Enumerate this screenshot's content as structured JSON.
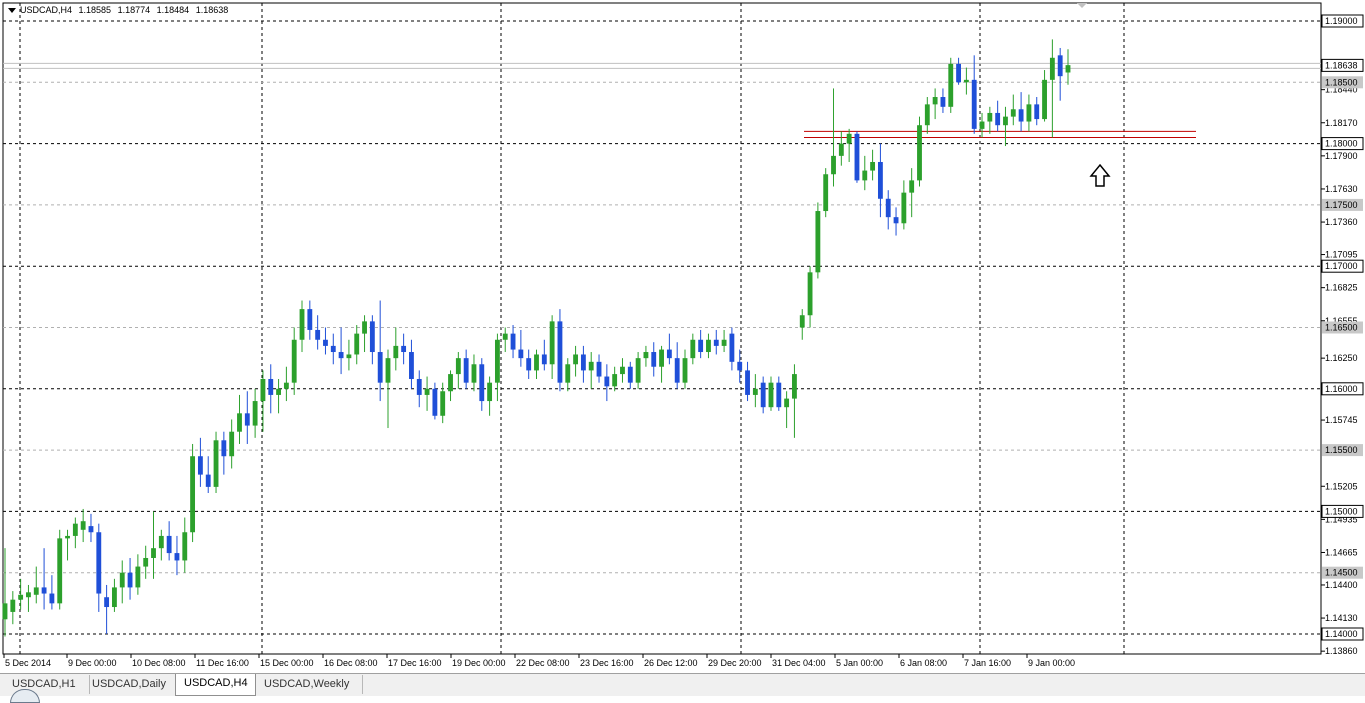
{
  "header": {
    "symbol": "USDCAD,H4",
    "open": "1.18585",
    "high": "1.18774",
    "low": "1.18484",
    "close": "1.18638"
  },
  "tabs": [
    {
      "label": "USDCAD,H1",
      "active": false
    },
    {
      "label": "USDCAD,Daily",
      "active": false
    },
    {
      "label": "USDCAD,H4",
      "active": true
    },
    {
      "label": "USDCAD,Weekly",
      "active": false
    }
  ],
  "colors": {
    "bull": "#2ca02c",
    "bear": "#1f4fd8",
    "resistance": "#c00000",
    "grid": "#000000",
    "minor_level": "#b0b0b0"
  },
  "chart_data": {
    "type": "candlestick",
    "timeframe": "H4",
    "ylim": [
      1.1363,
      1.192
    ],
    "price_ticks": [
      "1.19000",
      "1.18440",
      "1.18170",
      "1.17900",
      "1.17630",
      "1.17360",
      "1.17095",
      "1.16825",
      "1.16555",
      "1.16250",
      "1.15745",
      "1.15205",
      "1.14935",
      "1.14665",
      "1.14400",
      "1.14130",
      "1.13860"
    ],
    "major_levels": [
      "1.19000",
      "1.18000",
      "1.17000",
      "1.16000",
      "1.15000",
      "1.14000"
    ],
    "minor_levels": [
      "1.18500",
      "1.17500",
      "1.16500",
      "1.15500",
      "1.14500"
    ],
    "current_price": "1.18638",
    "current_price_value": 1.18638,
    "time_labels": [
      "5 Dec 2014",
      "9 Dec 00:00",
      "10 Dec 08:00",
      "11 Dec 16:00",
      "15 Dec 00:00",
      "16 Dec 08:00",
      "17 Dec 16:00",
      "19 Dec 00:00",
      "22 Dec 08:00",
      "23 Dec 16:00",
      "26 Dec 12:00",
      "29 Dec 20:00",
      "31 Dec 04:00",
      "5 Jan 00:00",
      "6 Jan 08:00",
      "7 Jan 16:00",
      "9 Jan 00:00"
    ],
    "resistance_zone": [
      1.1805,
      1.181
    ],
    "arrow": "up",
    "grid": true,
    "candles": [
      {
        "o": 1.1412,
        "h": 1.147,
        "l": 1.1398,
        "c": 1.1425
      },
      {
        "o": 1.1418,
        "h": 1.1435,
        "l": 1.1408,
        "c": 1.1428
      },
      {
        "o": 1.1428,
        "h": 1.1445,
        "l": 1.142,
        "c": 1.1432
      },
      {
        "o": 1.143,
        "h": 1.144,
        "l": 1.1418,
        "c": 1.1434
      },
      {
        "o": 1.1432,
        "h": 1.1455,
        "l": 1.1425,
        "c": 1.1438
      },
      {
        "o": 1.1438,
        "h": 1.147,
        "l": 1.142,
        "c": 1.1433
      },
      {
        "o": 1.1433,
        "h": 1.1448,
        "l": 1.142,
        "c": 1.1425
      },
      {
        "o": 1.1425,
        "h": 1.1485,
        "l": 1.142,
        "c": 1.1478
      },
      {
        "o": 1.1478,
        "h": 1.1485,
        "l": 1.146,
        "c": 1.148
      },
      {
        "o": 1.148,
        "h": 1.1495,
        "l": 1.147,
        "c": 1.149
      },
      {
        "o": 1.1485,
        "h": 1.1502,
        "l": 1.1475,
        "c": 1.1492
      },
      {
        "o": 1.1488,
        "h": 1.1498,
        "l": 1.1475,
        "c": 1.1483
      },
      {
        "o": 1.1483,
        "h": 1.149,
        "l": 1.1418,
        "c": 1.1433
      },
      {
        "o": 1.143,
        "h": 1.144,
        "l": 1.14,
        "c": 1.1422
      },
      {
        "o": 1.1422,
        "h": 1.1445,
        "l": 1.1418,
        "c": 1.1438
      },
      {
        "o": 1.1438,
        "h": 1.146,
        "l": 1.1425,
        "c": 1.145
      },
      {
        "o": 1.145,
        "h": 1.1462,
        "l": 1.1428,
        "c": 1.1438
      },
      {
        "o": 1.1438,
        "h": 1.1465,
        "l": 1.1432,
        "c": 1.1455
      },
      {
        "o": 1.1455,
        "h": 1.1472,
        "l": 1.1445,
        "c": 1.1462
      },
      {
        "o": 1.1462,
        "h": 1.15,
        "l": 1.1445,
        "c": 1.147
      },
      {
        "o": 1.147,
        "h": 1.1485,
        "l": 1.146,
        "c": 1.148
      },
      {
        "o": 1.148,
        "h": 1.1492,
        "l": 1.146,
        "c": 1.1466
      },
      {
        "o": 1.1466,
        "h": 1.148,
        "l": 1.1448,
        "c": 1.146
      },
      {
        "o": 1.146,
        "h": 1.1495,
        "l": 1.145,
        "c": 1.1483
      },
      {
        "o": 1.1483,
        "h": 1.1555,
        "l": 1.1475,
        "c": 1.1545
      },
      {
        "o": 1.1545,
        "h": 1.156,
        "l": 1.152,
        "c": 1.153
      },
      {
        "o": 1.153,
        "h": 1.1545,
        "l": 1.1515,
        "c": 1.152
      },
      {
        "o": 1.152,
        "h": 1.1565,
        "l": 1.1515,
        "c": 1.1558
      },
      {
        "o": 1.1558,
        "h": 1.1565,
        "l": 1.153,
        "c": 1.1545
      },
      {
        "o": 1.1545,
        "h": 1.1575,
        "l": 1.1535,
        "c": 1.1565
      },
      {
        "o": 1.1565,
        "h": 1.1595,
        "l": 1.1555,
        "c": 1.158
      },
      {
        "o": 1.158,
        "h": 1.1598,
        "l": 1.1555,
        "c": 1.157
      },
      {
        "o": 1.157,
        "h": 1.16,
        "l": 1.156,
        "c": 1.159
      },
      {
        "o": 1.159,
        "h": 1.1615,
        "l": 1.1565,
        "c": 1.1608
      },
      {
        "o": 1.1608,
        "h": 1.162,
        "l": 1.158,
        "c": 1.1595
      },
      {
        "o": 1.1595,
        "h": 1.1608,
        "l": 1.158,
        "c": 1.16
      },
      {
        "o": 1.16,
        "h": 1.1618,
        "l": 1.159,
        "c": 1.1605
      },
      {
        "o": 1.1605,
        "h": 1.165,
        "l": 1.1595,
        "c": 1.164
      },
      {
        "o": 1.164,
        "h": 1.1672,
        "l": 1.163,
        "c": 1.1665
      },
      {
        "o": 1.1665,
        "h": 1.1672,
        "l": 1.164,
        "c": 1.1648
      },
      {
        "o": 1.1648,
        "h": 1.166,
        "l": 1.1632,
        "c": 1.164
      },
      {
        "o": 1.164,
        "h": 1.165,
        "l": 1.1628,
        "c": 1.1635
      },
      {
        "o": 1.1635,
        "h": 1.1645,
        "l": 1.162,
        "c": 1.163
      },
      {
        "o": 1.163,
        "h": 1.165,
        "l": 1.1612,
        "c": 1.1625
      },
      {
        "o": 1.1625,
        "h": 1.164,
        "l": 1.1615,
        "c": 1.1628
      },
      {
        "o": 1.1628,
        "h": 1.1652,
        "l": 1.162,
        "c": 1.1645
      },
      {
        "o": 1.1645,
        "h": 1.166,
        "l": 1.163,
        "c": 1.1655
      },
      {
        "o": 1.1655,
        "h": 1.166,
        "l": 1.162,
        "c": 1.163
      },
      {
        "o": 1.163,
        "h": 1.1672,
        "l": 1.159,
        "c": 1.1605
      },
      {
        "o": 1.1605,
        "h": 1.1632,
        "l": 1.1568,
        "c": 1.1625
      },
      {
        "o": 1.1625,
        "h": 1.165,
        "l": 1.1615,
        "c": 1.1635
      },
      {
        "o": 1.1635,
        "h": 1.1645,
        "l": 1.162,
        "c": 1.163
      },
      {
        "o": 1.163,
        "h": 1.164,
        "l": 1.16,
        "c": 1.1608
      },
      {
        "o": 1.1608,
        "h": 1.1615,
        "l": 1.1585,
        "c": 1.1595
      },
      {
        "o": 1.1595,
        "h": 1.161,
        "l": 1.1582,
        "c": 1.16
      },
      {
        "o": 1.16,
        "h": 1.1605,
        "l": 1.1575,
        "c": 1.1578
      },
      {
        "o": 1.1578,
        "h": 1.1605,
        "l": 1.1572,
        "c": 1.1598
      },
      {
        "o": 1.1598,
        "h": 1.1615,
        "l": 1.159,
        "c": 1.1612
      },
      {
        "o": 1.1612,
        "h": 1.163,
        "l": 1.16,
        "c": 1.1625
      },
      {
        "o": 1.1625,
        "h": 1.1632,
        "l": 1.16,
        "c": 1.1605
      },
      {
        "o": 1.1605,
        "h": 1.1628,
        "l": 1.1598,
        "c": 1.162
      },
      {
        "o": 1.162,
        "h": 1.1625,
        "l": 1.1582,
        "c": 1.159
      },
      {
        "o": 1.159,
        "h": 1.161,
        "l": 1.1578,
        "c": 1.1605
      },
      {
        "o": 1.1605,
        "h": 1.1645,
        "l": 1.159,
        "c": 1.164
      },
      {
        "o": 1.164,
        "h": 1.165,
        "l": 1.163,
        "c": 1.1645
      },
      {
        "o": 1.1645,
        "h": 1.1652,
        "l": 1.1625,
        "c": 1.1632
      },
      {
        "o": 1.1632,
        "h": 1.1648,
        "l": 1.1618,
        "c": 1.1625
      },
      {
        "o": 1.1625,
        "h": 1.1632,
        "l": 1.1608,
        "c": 1.1615
      },
      {
        "o": 1.1615,
        "h": 1.1632,
        "l": 1.1608,
        "c": 1.1628
      },
      {
        "o": 1.1628,
        "h": 1.164,
        "l": 1.1615,
        "c": 1.162
      },
      {
        "o": 1.162,
        "h": 1.166,
        "l": 1.1608,
        "c": 1.1655
      },
      {
        "o": 1.1655,
        "h": 1.1665,
        "l": 1.1598,
        "c": 1.1605
      },
      {
        "o": 1.1605,
        "h": 1.1625,
        "l": 1.1598,
        "c": 1.162
      },
      {
        "o": 1.162,
        "h": 1.1635,
        "l": 1.161,
        "c": 1.1628
      },
      {
        "o": 1.1628,
        "h": 1.1635,
        "l": 1.1605,
        "c": 1.1615
      },
      {
        "o": 1.1615,
        "h": 1.163,
        "l": 1.16,
        "c": 1.1622
      },
      {
        "o": 1.1622,
        "h": 1.1628,
        "l": 1.1605,
        "c": 1.161
      },
      {
        "o": 1.161,
        "h": 1.162,
        "l": 1.159,
        "c": 1.1602
      },
      {
        "o": 1.1602,
        "h": 1.1618,
        "l": 1.1598,
        "c": 1.1612
      },
      {
        "o": 1.1612,
        "h": 1.1625,
        "l": 1.1605,
        "c": 1.1618
      },
      {
        "o": 1.1618,
        "h": 1.1622,
        "l": 1.16,
        "c": 1.1605
      },
      {
        "o": 1.1605,
        "h": 1.163,
        "l": 1.16,
        "c": 1.1625
      },
      {
        "o": 1.1625,
        "h": 1.1635,
        "l": 1.1618,
        "c": 1.163
      },
      {
        "o": 1.163,
        "h": 1.1638,
        "l": 1.161,
        "c": 1.1618
      },
      {
        "o": 1.1618,
        "h": 1.1635,
        "l": 1.1605,
        "c": 1.1632
      },
      {
        "o": 1.1632,
        "h": 1.1645,
        "l": 1.162,
        "c": 1.1625
      },
      {
        "o": 1.1625,
        "h": 1.1638,
        "l": 1.16,
        "c": 1.1605
      },
      {
        "o": 1.1605,
        "h": 1.1632,
        "l": 1.16,
        "c": 1.1625
      },
      {
        "o": 1.1625,
        "h": 1.1645,
        "l": 1.162,
        "c": 1.164
      },
      {
        "o": 1.164,
        "h": 1.1648,
        "l": 1.1625,
        "c": 1.163
      },
      {
        "o": 1.163,
        "h": 1.1645,
        "l": 1.1625,
        "c": 1.164
      },
      {
        "o": 1.164,
        "h": 1.1648,
        "l": 1.1628,
        "c": 1.1635
      },
      {
        "o": 1.1635,
        "h": 1.1648,
        "l": 1.163,
        "c": 1.164
      },
      {
        "o": 1.1645,
        "h": 1.165,
        "l": 1.1615,
        "c": 1.1622
      },
      {
        "o": 1.1622,
        "h": 1.1632,
        "l": 1.1605,
        "c": 1.1615
      },
      {
        "o": 1.1615,
        "h": 1.1622,
        "l": 1.159,
        "c": 1.1595
      },
      {
        "o": 1.1595,
        "h": 1.1612,
        "l": 1.1585,
        "c": 1.16
      },
      {
        "o": 1.1605,
        "h": 1.161,
        "l": 1.158,
        "c": 1.1585
      },
      {
        "o": 1.1585,
        "h": 1.161,
        "l": 1.1582,
        "c": 1.1605
      },
      {
        "o": 1.1605,
        "h": 1.161,
        "l": 1.1582,
        "c": 1.1585
      },
      {
        "o": 1.1585,
        "h": 1.1598,
        "l": 1.1568,
        "c": 1.1592
      },
      {
        "o": 1.1592,
        "h": 1.162,
        "l": 1.156,
        "c": 1.1612
      },
      {
        "o": 1.165,
        "h": 1.1665,
        "l": 1.164,
        "c": 1.166
      },
      {
        "o": 1.166,
        "h": 1.17,
        "l": 1.165,
        "c": 1.1695
      },
      {
        "o": 1.1695,
        "h": 1.1752,
        "l": 1.169,
        "c": 1.1745
      },
      {
        "o": 1.1745,
        "h": 1.178,
        "l": 1.174,
        "c": 1.1775
      },
      {
        "o": 1.1775,
        "h": 1.1845,
        "l": 1.1765,
        "c": 1.179
      },
      {
        "o": 1.179,
        "h": 1.181,
        "l": 1.1782,
        "c": 1.18
      },
      {
        "o": 1.18,
        "h": 1.1812,
        "l": 1.1785,
        "c": 1.1808
      },
      {
        "o": 1.1808,
        "h": 1.181,
        "l": 1.1768,
        "c": 1.177
      },
      {
        "o": 1.177,
        "h": 1.179,
        "l": 1.1762,
        "c": 1.1778
      },
      {
        "o": 1.1778,
        "h": 1.1795,
        "l": 1.177,
        "c": 1.1785
      },
      {
        "o": 1.1785,
        "h": 1.18,
        "l": 1.174,
        "c": 1.1755
      },
      {
        "o": 1.1755,
        "h": 1.1762,
        "l": 1.173,
        "c": 1.174
      },
      {
        "o": 1.174,
        "h": 1.1748,
        "l": 1.1725,
        "c": 1.1735
      },
      {
        "o": 1.1735,
        "h": 1.177,
        "l": 1.173,
        "c": 1.176
      },
      {
        "o": 1.176,
        "h": 1.178,
        "l": 1.174,
        "c": 1.177
      },
      {
        "o": 1.177,
        "h": 1.1822,
        "l": 1.1765,
        "c": 1.1815
      },
      {
        "o": 1.1815,
        "h": 1.1838,
        "l": 1.1808,
        "c": 1.1832
      },
      {
        "o": 1.1832,
        "h": 1.1845,
        "l": 1.182,
        "c": 1.1838
      },
      {
        "o": 1.1838,
        "h": 1.1845,
        "l": 1.1825,
        "c": 1.183
      },
      {
        "o": 1.183,
        "h": 1.187,
        "l": 1.1825,
        "c": 1.1865
      },
      {
        "o": 1.1865,
        "h": 1.187,
        "l": 1.1848,
        "c": 1.185
      },
      {
        "o": 1.185,
        "h": 1.1862,
        "l": 1.184,
        "c": 1.1852
      },
      {
        "o": 1.1852,
        "h": 1.1872,
        "l": 1.1808,
        "c": 1.1812
      },
      {
        "o": 1.1812,
        "h": 1.1825,
        "l": 1.1805,
        "c": 1.1818
      },
      {
        "o": 1.1818,
        "h": 1.183,
        "l": 1.1808,
        "c": 1.1825
      },
      {
        "o": 1.1825,
        "h": 1.1835,
        "l": 1.181,
        "c": 1.1815
      },
      {
        "o": 1.1815,
        "h": 1.183,
        "l": 1.1798,
        "c": 1.1822
      },
      {
        "o": 1.1822,
        "h": 1.184,
        "l": 1.1815,
        "c": 1.1828
      },
      {
        "o": 1.1828,
        "h": 1.1842,
        "l": 1.181,
        "c": 1.1818
      },
      {
        "o": 1.1818,
        "h": 1.184,
        "l": 1.181,
        "c": 1.1832
      },
      {
        "o": 1.1832,
        "h": 1.1838,
        "l": 1.1815,
        "c": 1.182
      },
      {
        "o": 1.182,
        "h": 1.186,
        "l": 1.1818,
        "c": 1.1852
      },
      {
        "o": 1.1852,
        "h": 1.1885,
        "l": 1.1805,
        "c": 1.187
      },
      {
        "o": 1.1872,
        "h": 1.1878,
        "l": 1.1835,
        "c": 1.1855
      },
      {
        "o": 1.1858,
        "h": 1.1877,
        "l": 1.1848,
        "c": 1.1864
      }
    ]
  }
}
